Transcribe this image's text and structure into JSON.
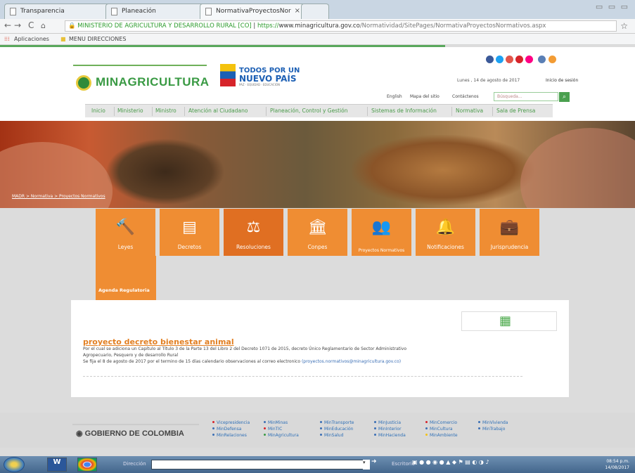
{
  "browser": {
    "tabs": [
      {
        "title": "Transparencia"
      },
      {
        "title": "Planeación"
      },
      {
        "title": "NormativaProyectosNor"
      }
    ],
    "close_glyph": "×",
    "url_site": "MINISTERIO DE AGRICULTURA Y DESARROLLO RURAL [CO]",
    "url_separator": "|",
    "url_scheme": "https://",
    "url_host": "www.minagricultura.gov.co",
    "url_path": "/Normatividad/SitePages/NormativaProyectosNormativos.aspx",
    "bookmarks": [
      {
        "label": "Aplicaciones"
      },
      {
        "label": "MENU DIRECCIONES"
      }
    ]
  },
  "site": {
    "logo": "MINAGRICULTURA",
    "tpu_line1": "TODOS POR UN",
    "tpu_line2": "NUEVO PAÍS",
    "tpu_sub": "PAZ · EQUIDAD · EDUCACIÓN",
    "social_icons": [
      "facebook-icon",
      "twitter-icon",
      "flickr-icon",
      "youtube-icon",
      "flickr2-icon",
      "instagram-icon",
      "rss-icon"
    ],
    "social_colors": [
      "#3b5998",
      "#1da1f2",
      "#e2564b",
      "#d6242a",
      "#ff0084",
      "#5a7fb5",
      "#f39c34"
    ],
    "date": "Lunes , 14 de agosto de 2017",
    "login": "Inicio de sesión",
    "top_links": [
      "English",
      "Mapa del sitio",
      "Contáctenos"
    ],
    "search_placeholder": "Búsqueda...",
    "menu": [
      "Inicio",
      "Ministerio",
      "Ministro",
      "Atención al Ciudadano",
      "Planeación, Control y Gestión",
      "Sistemas de Información",
      "Normativa",
      "Sala de Prensa"
    ],
    "breadcrumb": "MADR > Normativa > Proyectos Normativos",
    "tiles": [
      {
        "label": "Leyes",
        "icon": "gavel-icon"
      },
      {
        "label": "Decretos",
        "icon": "document-icon"
      },
      {
        "label": "Resoluciones",
        "icon": "scales-icon"
      },
      {
        "label": "Conpes",
        "icon": "institution-icon"
      },
      {
        "label": "Proyectos Normativos",
        "icon": "people-plus-icon"
      },
      {
        "label": "Notificaciones",
        "icon": "bell-icon"
      },
      {
        "label": "Jurisprudencia",
        "icon": "briefcase-icon"
      }
    ],
    "agenda": "Agenda Regulatoria",
    "accent_color": "#ef8d33",
    "brand_color": "#3a9a44"
  },
  "project": {
    "title": "proyecto decreto bienestar animal",
    "desc_line1": "Por el cual se adiciona un Capítulo al Título 3 de la Parte 13 del Libro 2 del Decreto 1071 de 2015, decreto Único Reglamentario de Sector Administrativo",
    "desc_line2": "Agropecuario, Pesquero y de desarrollo Rural",
    "desc_line3_pre": "Se fija el 8 de agosto de 2017 por el termino de 15 días calendario observaciones al correo electronico",
    "email": "(proyectos.normativos@minagricultura.gov.co)"
  },
  "footer": {
    "gov": "GOBIERNO DE COLOMBIA",
    "links": [
      {
        "label": "Vicepresidencia",
        "color": "#d6242a"
      },
      {
        "label": "MinDefensa",
        "color": "#3b6fb5"
      },
      {
        "label": "MinRelaciones",
        "color": "#3b6fb5"
      },
      {
        "label": "MinMinas",
        "color": "#3b6fb5"
      },
      {
        "label": "MinTIC",
        "color": "#d6242a"
      },
      {
        "label": "MinAgricultura",
        "color": "#3a9a44"
      },
      {
        "label": "MinTransporte",
        "color": "#3b6fb5"
      },
      {
        "label": "MinEducación",
        "color": "#3b6fb5"
      },
      {
        "label": "MinSalud",
        "color": "#3b6fb5"
      },
      {
        "label": "MinJusticia",
        "color": "#3b6fb5"
      },
      {
        "label": "MinInterior",
        "color": "#3b6fb5"
      },
      {
        "label": "MinHacienda",
        "color": "#3b6fb5"
      },
      {
        "label": "MinComercio",
        "color": "#d6242a"
      },
      {
        "label": "MinCultura",
        "color": "#3b6fb5"
      },
      {
        "label": "MinAmbiente",
        "color": "#f4c20d"
      },
      {
        "label": "MinVivienda",
        "color": "#3b6fb5"
      },
      {
        "label": "MinTrabajo",
        "color": "#3b6fb5"
      }
    ]
  },
  "taskbar": {
    "direccion": "Dirección",
    "escritorio": "Escritorio",
    "time": "08:54 p.m.",
    "date": "14/08/2017"
  }
}
